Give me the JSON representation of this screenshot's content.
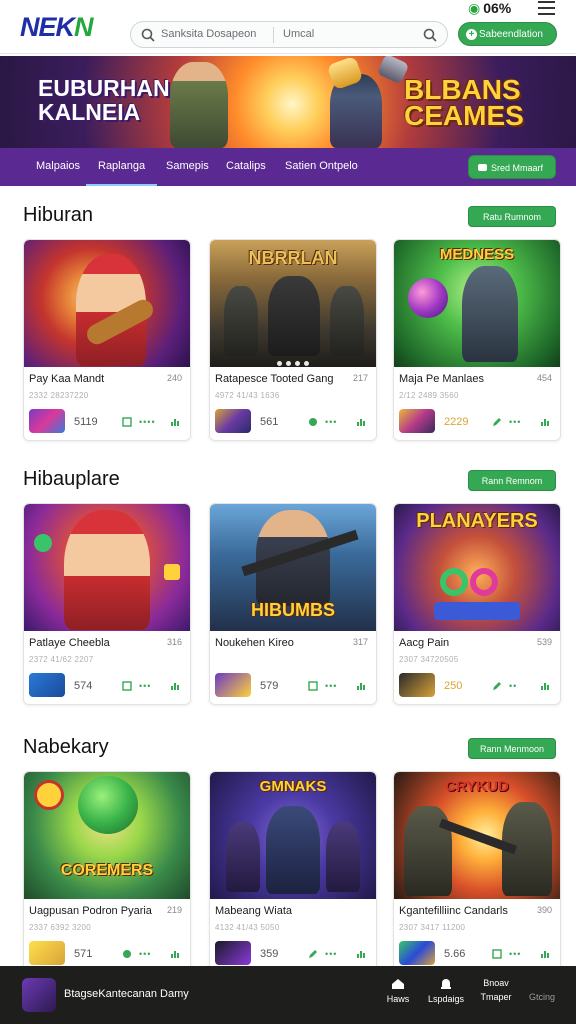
{
  "header": {
    "logo_main": "NEK",
    "logo_accent": "N",
    "search_placeholder": "Sanksita Dosapeon",
    "search_location": "Umcal",
    "status_text": "06%",
    "subscribe_label": "Sabeendlation"
  },
  "banner": {
    "left_line1": "EUBURHAN",
    "left_line2": "KALNEIA",
    "right_line1": "BLBANS",
    "right_line2": "CEAMES"
  },
  "nav": {
    "tabs": [
      {
        "label": "Malpaios",
        "active": false
      },
      {
        "label": "Raplanga",
        "active": true
      },
      {
        "label": "Samepis",
        "active": false
      },
      {
        "label": "Catalips",
        "active": false
      },
      {
        "label": "Satien  Ontpelo",
        "active": false
      }
    ],
    "button_label": "Sred Mmaarf"
  },
  "sections": [
    {
      "title": "Hiburan",
      "button": "Ratu Rumnom",
      "cards": [
        {
          "title": "Pay Kaa Mandt",
          "num": "240",
          "meta": "2332 28237220",
          "count": "5119",
          "art": ""
        },
        {
          "title": "Ratapesce  Tooted Gang",
          "num": "217",
          "meta": "4972 41/43 1636",
          "count": "561",
          "art": "NBRRLAN"
        },
        {
          "title": "Maja Pe Manlaes",
          "num": "454",
          "meta": "2/12 2489 3560",
          "count": "2229",
          "art": "MEDNESS"
        }
      ]
    },
    {
      "title": "Hibauplare",
      "button": "Rann Remnom",
      "cards": [
        {
          "title": "Patlaye Cheebla",
          "num": "316",
          "meta": "2372 41/62 2207",
          "count": "574",
          "art": ""
        },
        {
          "title": "Noukehen Kireo",
          "num": "317",
          "meta": "",
          "count": "579",
          "art": "HIBUMBS"
        },
        {
          "title": "Aacg Pain",
          "num": "539",
          "meta": "2307 34720505",
          "count": "250",
          "art": "PLANAYERS"
        }
      ]
    },
    {
      "title": "Nabekary",
      "button": "Rann Menmoon",
      "cards": [
        {
          "title": "Uagpusan Podron Pyaria",
          "num": "219",
          "meta": "2337 6392 3200",
          "count": "571",
          "art": "COREMERS"
        },
        {
          "title": "Mabeang Wiata",
          "num": "",
          "meta": "4132 41/43 5050",
          "count": "359",
          "art": "GMNAKS"
        },
        {
          "title": "Kgantefilliinc Candarls",
          "num": "390",
          "meta": "2307 3417 11200",
          "count": "5.66",
          "art": "CRYKUD"
        }
      ]
    }
  ],
  "bottom": {
    "name": "BtagseKantecanan Damy",
    "items": [
      {
        "label": "Haws",
        "dim": false
      },
      {
        "label": "Lspdaigs",
        "dim": false
      },
      {
        "label": "Tmaper",
        "dim": false
      },
      {
        "label": "Gtcing",
        "dim": true
      }
    ],
    "item3_top": "Bnoav"
  }
}
